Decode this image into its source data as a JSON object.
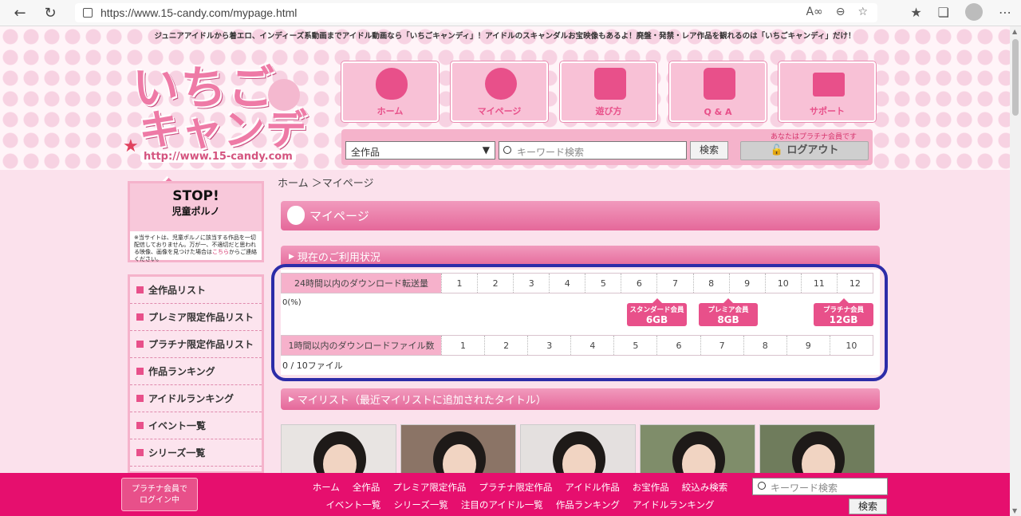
{
  "browser": {
    "url": "https://www.15-candy.com/mypage.html"
  },
  "header": {
    "tagline": "ジュニアアイドルから着エロ、インディーズ系動画までアイドル動画なら「いちごキャンディ」！アイドルのスキャンダルお宝映像もあるよ！廃盤・発禁・レア作品を観れるのは「いちごキャンディ」だけ！",
    "logo_line1": "いちご",
    "logo_line2": "キャンディ",
    "logo_url": "http://www.15-candy.com",
    "nav": [
      "ホーム",
      "マイページ",
      "遊び方",
      "Q & A",
      "サポート"
    ],
    "member_note": "あなたはプラチナ会員です",
    "category_selected": "全作品",
    "search_placeholder": "キーワード検索",
    "search_button": "検索",
    "logout_button": "ログアウト"
  },
  "sidebar": {
    "stop_title": "STOP!",
    "stop_sub": "児童ポルノ",
    "stop_note_a": "※当サイトは、児童ポルノに該当する作品を一切配信しておりません。万が一、不適切だと思われる映像、画像を見つけた場合は",
    "stop_note_link": "こちら",
    "stop_note_b": "からご連絡ください。",
    "menu": [
      "全作品リスト",
      "プレミア限定作品リスト",
      "プラチナ限定作品リスト",
      "作品ランキング",
      "アイドルランキング",
      "イベント一覧",
      "シリーズ一覧"
    ]
  },
  "main": {
    "breadcrumb": "ホーム ＞マイページ",
    "page_title": "マイページ",
    "usage_section": "現在のご利用状況",
    "transfer_label": "24時間以内のダウンロード転送量",
    "transfer_cells": [
      "1",
      "2",
      "3",
      "4",
      "5",
      "6",
      "7",
      "8",
      "9",
      "10",
      "11",
      "12"
    ],
    "transfer_pct": "0(%)",
    "badges": [
      {
        "name": "スタンダード会員",
        "size": "6GB"
      },
      {
        "name": "プレミア会員",
        "size": "8GB"
      },
      {
        "name": "プラチナ会員",
        "size": "12GB"
      }
    ],
    "files_label": "1時間以内のダウンロードファイル数",
    "files_cells": [
      "1",
      "2",
      "3",
      "4",
      "5",
      "6",
      "7",
      "8",
      "9",
      "10"
    ],
    "files_count": "0 / 10ファイル",
    "mylist_section": "マイリスト（最近マイリストに追加されたタイトル）"
  },
  "footer": {
    "platinum_line1": "プラチナ会員で",
    "platinum_line2": "ログイン中",
    "links_row1": [
      "ホーム",
      "全作品",
      "プレミア限定作品",
      "プラチナ限定作品",
      "アイドル作品",
      "お宝作品",
      "絞込み検索"
    ],
    "links_row2": [
      "イベント一覧",
      "シリーズ一覧",
      "注目のアイドル一覧",
      "作品ランキング",
      "アイドルランキング"
    ],
    "search_placeholder": "キーワード検索",
    "search_button": "検索"
  },
  "colors": {
    "accent": "#e8508a",
    "footer": "#e60f6e",
    "highlight_outline": "#2c2ca8"
  }
}
